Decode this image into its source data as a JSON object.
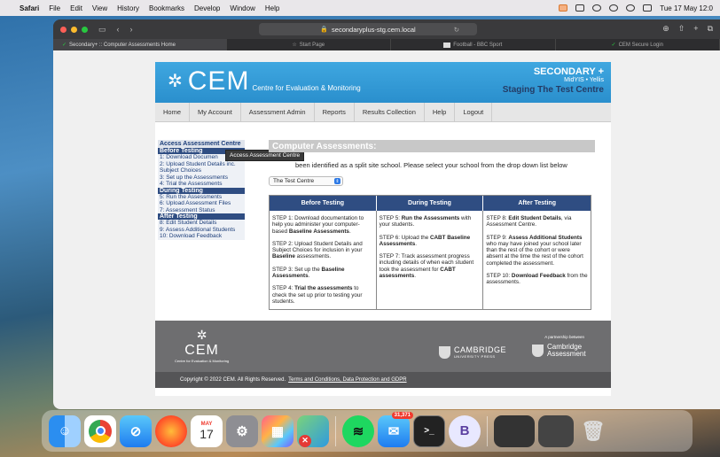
{
  "menubar": {
    "items": [
      "Safari",
      "File",
      "Edit",
      "View",
      "History",
      "Bookmarks",
      "Develop",
      "Window",
      "Help"
    ],
    "clock": "Tue 17 May 12:0"
  },
  "browser": {
    "url": "secondaryplus-stg.cem.local",
    "tabs": [
      {
        "label": "Secondary+ :: Computer Assessments Home",
        "active": true
      },
      {
        "label": "Start Page",
        "active": false
      },
      {
        "label": "Football - BBC Sport",
        "active": false
      },
      {
        "label": "CEM Secure Login",
        "active": false
      }
    ]
  },
  "header": {
    "logo": "CEM",
    "subtitle": "Centre for Evaluation & Monitoring",
    "product": "SECONDARY +",
    "product_sub": "MidYIS • Yellis",
    "centre": "Staging The Test Centre"
  },
  "nav": [
    "Home",
    "My Account",
    "Assessment Admin",
    "Reports",
    "Results Collection",
    "Help",
    "Logout"
  ],
  "sidebar": {
    "heading": "Access Assessment Centre",
    "sections": [
      {
        "title": "Before Testing",
        "items": [
          "1: Download Documen",
          "2: Upload Student Details inc. Subject Choices",
          "3: Set up the Assessments",
          "4: Trial the Assessments"
        ]
      },
      {
        "title": "During Testing",
        "items": [
          "5: Run the Assessments",
          "6: Upload Assessment Files",
          "7: Assessment Status"
        ]
      },
      {
        "title": "After Testing",
        "items": [
          "8: Edit Student Details",
          "9: Assess Additional Students",
          "10: Download Feedback"
        ]
      }
    ],
    "tooltip": "Access Assessment Centre"
  },
  "main": {
    "title": "Computer Assessments:",
    "intro": "been identified as a split site school. Please select your school from the drop down list below",
    "school_selected": "The Test Centre",
    "columns": [
      {
        "heading": "Before Testing"
      },
      {
        "heading": "During Testing"
      },
      {
        "heading": "After Testing"
      }
    ]
  },
  "footer": {
    "logo": "CEM",
    "logo_tag": "Centre for Evaluation & Monitoring",
    "partnership": "A partnership between",
    "cup": "CAMBRIDGE",
    "cup_sub": "UNIVERSITY PRESS",
    "ca1": "Cambridge",
    "ca2": "Assessment",
    "copyright": "Copyright © 2022 CEM. All Rights Reserved.",
    "links": "Terms and Conditions, Data Protection and GDPR"
  },
  "dock": {
    "calendar_month": "MAY",
    "calendar_day": "17",
    "mail_badge": "31,371"
  }
}
